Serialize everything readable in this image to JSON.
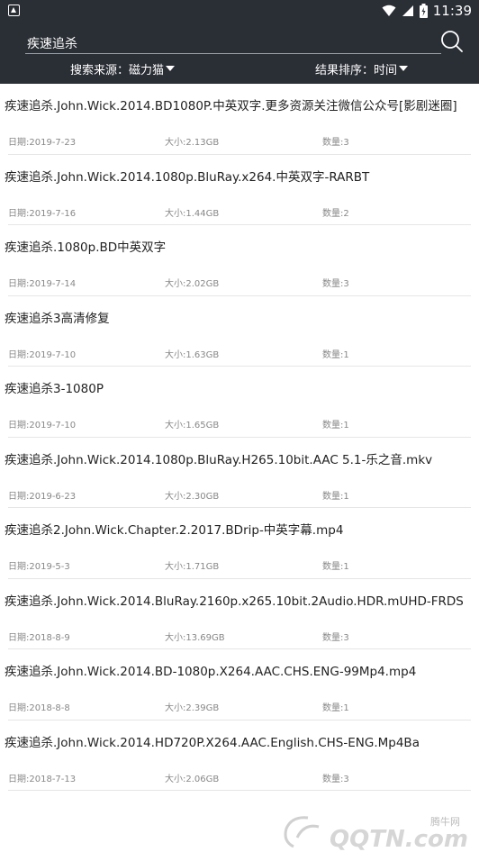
{
  "status_bar": {
    "time": "11:39"
  },
  "search": {
    "query": "疾速追杀"
  },
  "filters": {
    "source_label": "搜索来源：磁力猫",
    "sort_label": "结果排序：时间"
  },
  "results": [
    {
      "title": "疾速追杀.John.Wick.2014.BD1080P.中英双字.更多资源关注微信公众号[影剧迷圈]",
      "date": "日期:2019-7-23",
      "size": "大小:2.13GB",
      "count": "数量:3"
    },
    {
      "title": "疾速追杀.John.Wick.2014.1080p.BluRay.x264.中英双字-RARBT",
      "date": "日期:2019-7-16",
      "size": "大小:1.44GB",
      "count": "数量:2"
    },
    {
      "title": "疾速追杀.1080p.BD中英双字",
      "date": "日期:2019-7-14",
      "size": "大小:2.02GB",
      "count": "数量:3"
    },
    {
      "title": "疾速追杀3高清修复",
      "date": "日期:2019-7-10",
      "size": "大小:1.63GB",
      "count": "数量:1"
    },
    {
      "title": "疾速追杀3-1080P",
      "date": "日期:2019-7-10",
      "size": "大小:1.65GB",
      "count": "数量:1"
    },
    {
      "title": "疾速追杀.John.Wick.2014.1080p.BluRay.H265.10bit.AAC 5.1-乐之音.mkv",
      "date": "日期:2019-6-23",
      "size": "大小:2.30GB",
      "count": "数量:1"
    },
    {
      "title": "疾速追杀2.John.Wick.Chapter.2.2017.BDrip-中英字幕.mp4",
      "date": "日期:2019-5-3",
      "size": "大小:1.71GB",
      "count": "数量:1"
    },
    {
      "title": "疾速追杀.John.Wick.2014.BluRay.2160p.x265.10bit.2Audio.HDR.mUHD-FRDS",
      "date": "日期:2018-8-9",
      "size": "大小:13.69GB",
      "count": "数量:3"
    },
    {
      "title": "疾速追杀.John.Wick.2014.BD-1080p.X264.AAC.CHS.ENG-99Mp4.mp4",
      "date": "日期:2018-8-8",
      "size": "大小:2.39GB",
      "count": "数量:1"
    },
    {
      "title": "疾速追杀.John.Wick.2014.HD720P.X264.AAC.English.CHS-ENG.Mp4Ba",
      "date": "日期:2018-7-13",
      "size": "大小:2.06GB",
      "count": "数量:3"
    }
  ],
  "watermark": {
    "brand": "腾牛网",
    "text": "QQTN.com"
  },
  "colors": {
    "header_bg": "#2a2e35",
    "text": "#222222",
    "meta": "#888888"
  }
}
